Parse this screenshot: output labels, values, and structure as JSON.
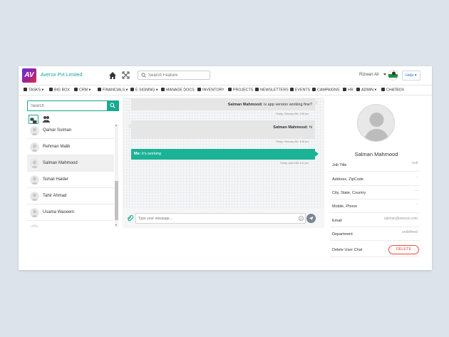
{
  "company": "Averox Pvt Limited",
  "search_placeholder": "Search Feature",
  "user": {
    "name": "Rizwan Ali"
  },
  "help_label": "Help",
  "menu": [
    "TASKS",
    "BIG BOX",
    "CRM",
    "FINANCIALS",
    "E SIGNING",
    "MANAGE DOCS",
    "INVENTORY",
    "PROJECTS",
    "NEWSLETTERS",
    "EVENTS",
    "CAMPAIGNS",
    "HR",
    "ADMIN",
    "CHATBOX"
  ],
  "sidebar": {
    "search_placeholder": "Search",
    "contacts": [
      "Qamar Sulman",
      "Rehman Malik",
      "Salman Mahmood",
      "Sohail Haider",
      "Tahir Ahmad",
      "Usama Waseem"
    ]
  },
  "chat": {
    "messages": [
      {
        "sender": "Salman Mahmood:",
        "text": "is app version working fine?",
        "time": "Friday, February 8th, 3:50 pm"
      },
      {
        "sender": "Salman Mahmood:",
        "text": "hi",
        "time": "Friday, February 8th, 4:38 pm"
      },
      {
        "sender": "Me:",
        "text": "it's working",
        "time": "Friday, April 19th 4:43 pm"
      }
    ],
    "compose_placeholder": "Type your message..."
  },
  "profile": {
    "name": "Salman Mahmood",
    "fields": [
      {
        "label": "Job Title",
        "value": "null"
      },
      {
        "label": "Address, ZipCode",
        "value": "-"
      },
      {
        "label": "City, State, Country",
        "value": "- -"
      },
      {
        "label": "Mobile, Phone",
        "value": "-"
      },
      {
        "label": "Email",
        "value": "salman@averox.com"
      },
      {
        "label": "Department",
        "value": "undefined"
      }
    ],
    "delete_label": "Delete User Chat",
    "delete_button": "DELETE"
  },
  "colors": {
    "accent": "#1ab395",
    "delete": "#e74c3c"
  }
}
